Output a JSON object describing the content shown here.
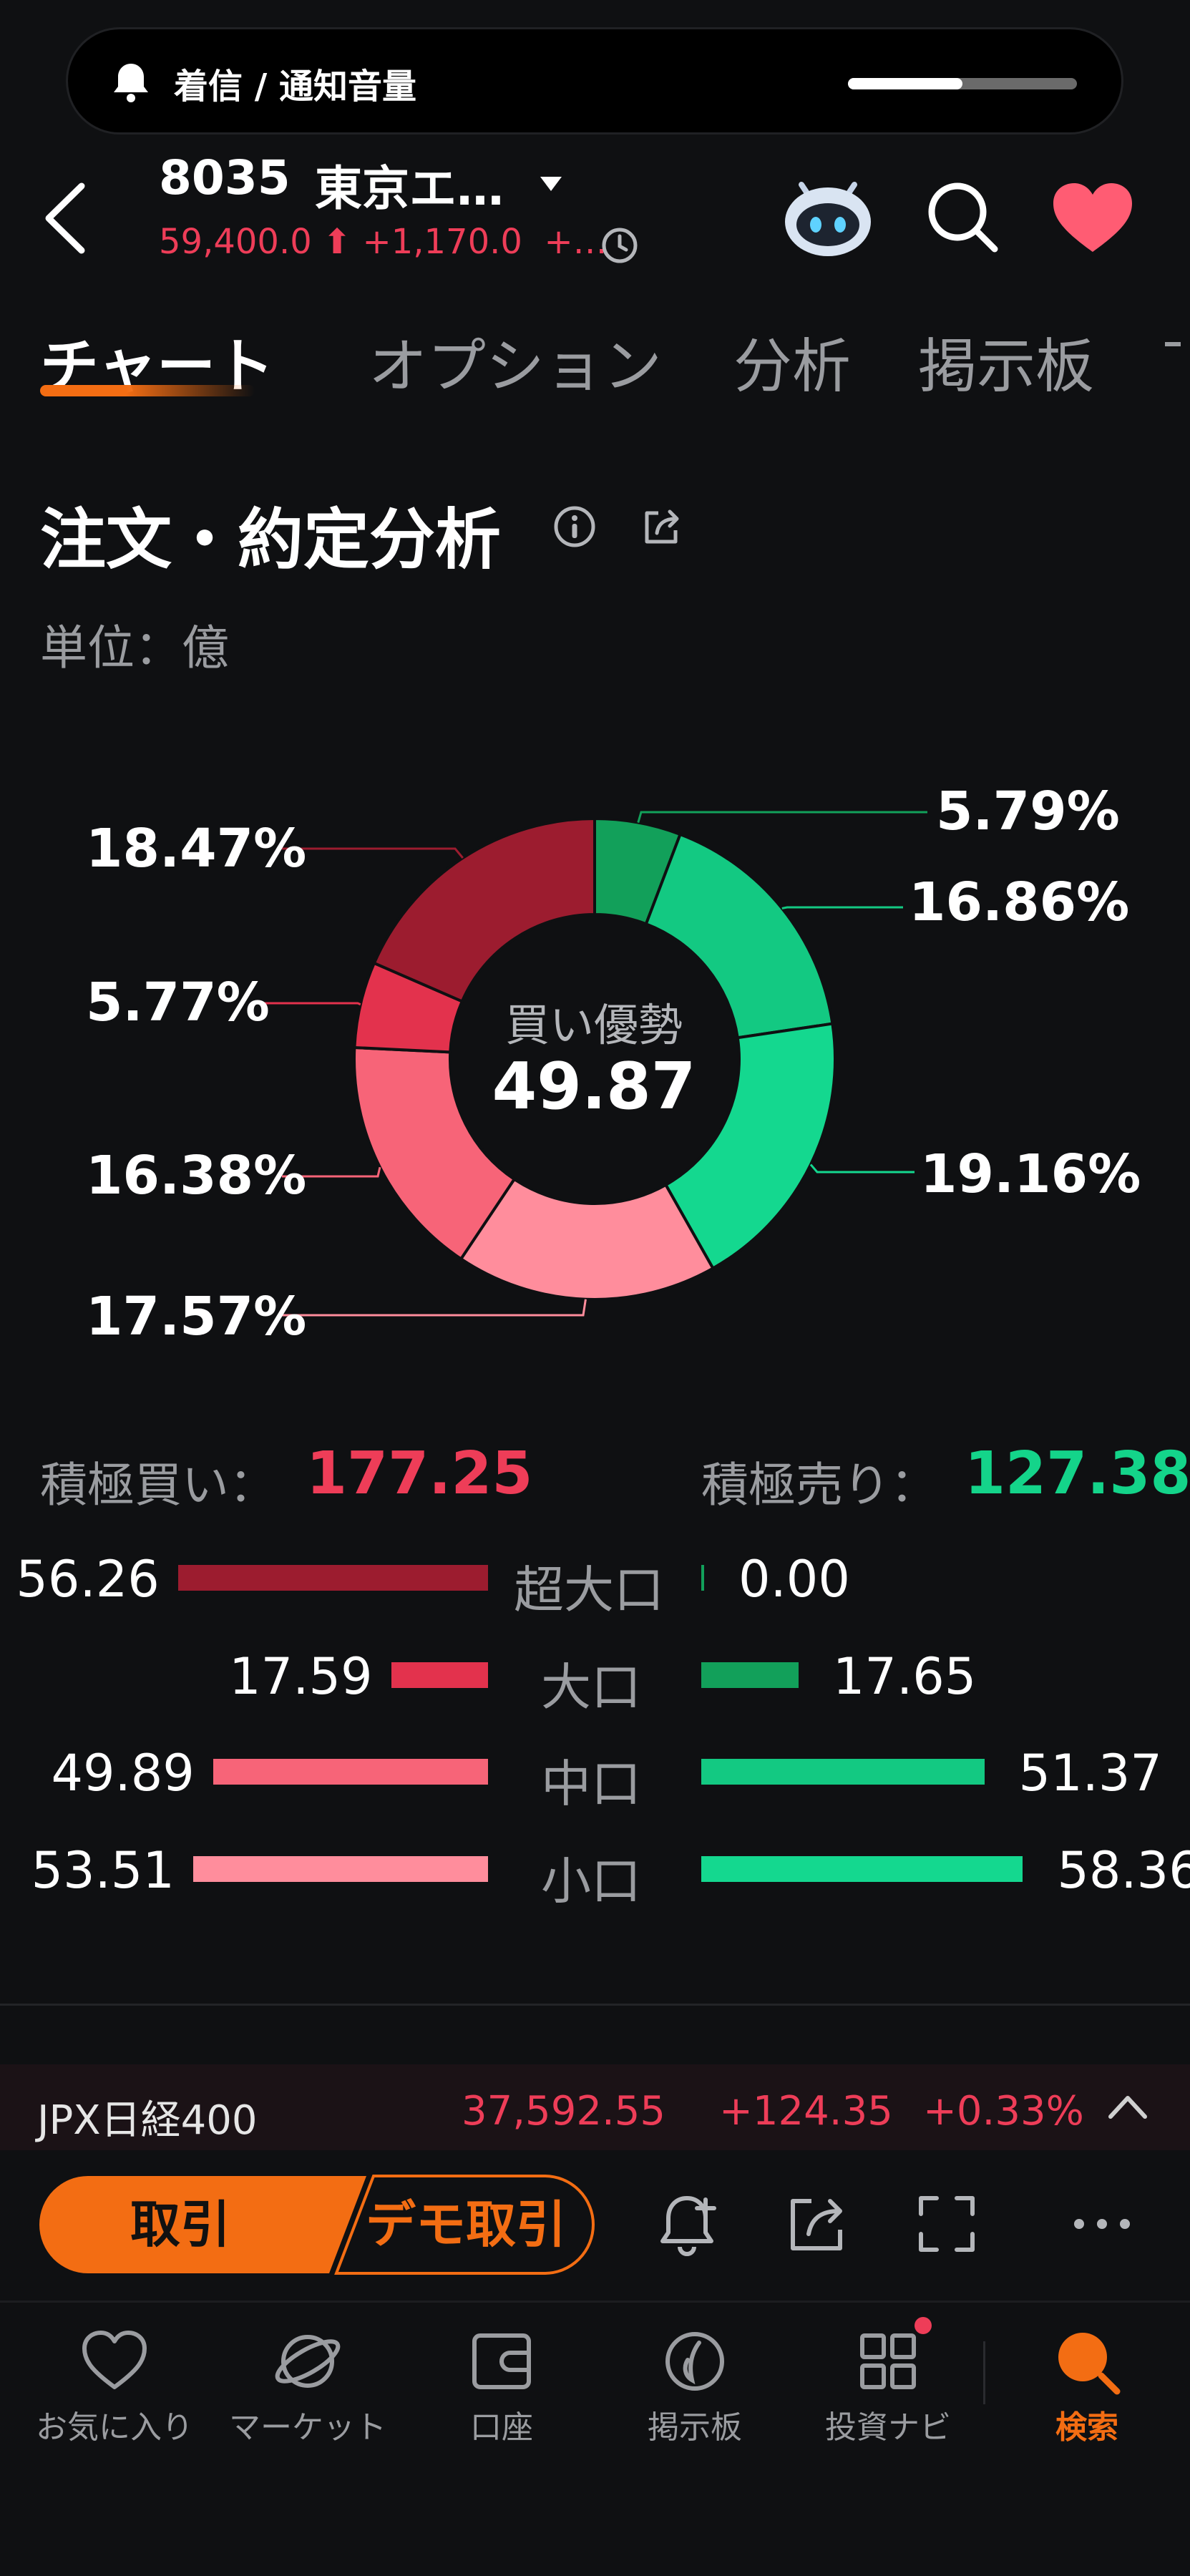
{
  "notification": {
    "text": "着信 / 通知音量",
    "volume_level": 0.5
  },
  "header": {
    "code": "8035",
    "name": "東京エ…",
    "price": "59,400.0",
    "change": "+1,170.0",
    "change_pct": "+…"
  },
  "tabs": [
    {
      "label": "チャート",
      "active": true
    },
    {
      "label": "オプション",
      "active": false
    },
    {
      "label": "分析",
      "active": false
    },
    {
      "label": "掲示板",
      "active": false
    }
  ],
  "section": {
    "title": "注文・約定分析",
    "unit": "単位：億"
  },
  "chart_data": {
    "type": "pie",
    "donut": true,
    "center_label": "買い優勢",
    "center_value": "49.87",
    "slices": [
      {
        "label": "5.79%",
        "value": 5.79,
        "color": "#12a05a"
      },
      {
        "label": "16.86%",
        "value": 16.86,
        "color": "#13c982"
      },
      {
        "label": "19.16%",
        "value": 19.16,
        "color": "#14d88f"
      },
      {
        "label": "17.57%",
        "value": 17.57,
        "color": "#ff8d9c"
      },
      {
        "label": "16.38%",
        "value": 16.38,
        "color": "#f76478"
      },
      {
        "label": "5.77%",
        "value": 5.77,
        "color": "#e3324d"
      },
      {
        "label": "18.47%",
        "value": 18.47,
        "color": "#9c1c2f"
      }
    ]
  },
  "totals": {
    "buy_label": "積極買い：",
    "buy_value": "177.25",
    "sell_label": "積極売り：",
    "sell_value": "127.38"
  },
  "rows": [
    {
      "label": "超大口",
      "buy": "56.26",
      "sell": "0.00",
      "buy_num": 56.26,
      "sell_num": 0.0,
      "buy_color": "#9c1c2f",
      "sell_color": "#12a05a"
    },
    {
      "label": "大口",
      "buy": "17.59",
      "sell": "17.65",
      "buy_num": 17.59,
      "sell_num": 17.65,
      "buy_color": "#e3324d",
      "sell_color": "#12a05a"
    },
    {
      "label": "中口",
      "buy": "49.89",
      "sell": "51.37",
      "buy_num": 49.89,
      "sell_num": 51.37,
      "buy_color": "#f76478",
      "sell_color": "#13c982"
    },
    {
      "label": "小口",
      "buy": "53.51",
      "sell": "58.36",
      "buy_num": 53.51,
      "sell_num": 58.36,
      "buy_color": "#ff8d9c",
      "sell_color": "#14d88f"
    }
  ],
  "index_strip": {
    "name": "JPX日経400",
    "value": "37,592.55",
    "change": "+124.35",
    "change_pct": "+0.33%"
  },
  "actions": {
    "trade_label": "取引",
    "demo_label": "デモ取引",
    "icons": [
      "bell-plus-icon",
      "share-icon",
      "fullscreen-icon",
      "more-icon"
    ]
  },
  "nav": [
    {
      "label": "お気に入り",
      "icon": "heart-icon"
    },
    {
      "label": "マーケット",
      "icon": "planet-icon"
    },
    {
      "label": "口座",
      "icon": "wallet-icon"
    },
    {
      "label": "掲示板",
      "icon": "board-icon"
    },
    {
      "label": "投資ナビ",
      "icon": "grid-icon"
    },
    {
      "label": "検索",
      "icon": "search-icon"
    }
  ],
  "colors": {
    "accent": "#f36d13",
    "up": "#ee3d58",
    "down": "#14d48a",
    "background": "#0f1012"
  }
}
